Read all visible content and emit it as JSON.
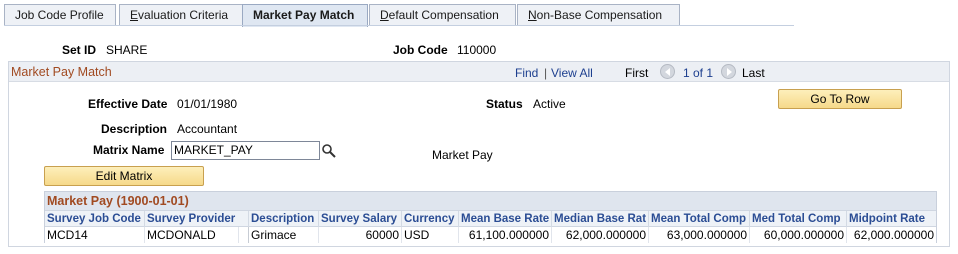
{
  "tabs": [
    {
      "label": "Job Code Profile",
      "underline": "",
      "rest": "Job Code Profile"
    },
    {
      "label": "Evaluation Criteria",
      "underline": "E",
      "rest": "valuation Criteria"
    },
    {
      "label": "Market Pay Match",
      "underline": "",
      "rest": "Market Pay Match",
      "active": true
    },
    {
      "label": "Default Compensation",
      "underline": "D",
      "rest": "efault Compensation"
    },
    {
      "label": "Non-Base Compensation",
      "underline": "N",
      "rest": "on-Base Compensation"
    }
  ],
  "header": {
    "setid_label": "Set ID",
    "setid_value": "SHARE",
    "jobcode_label": "Job Code",
    "jobcode_value": "110000"
  },
  "section": {
    "title": "Market Pay Match",
    "find": "Find",
    "sep": "|",
    "view_all": "View All",
    "first": "First",
    "count": "1 of 1",
    "last": "Last"
  },
  "fields": {
    "effdt_label": "Effective Date",
    "effdt_value": "01/01/1980",
    "status_label": "Status",
    "status_value": "Active",
    "descr_label": "Description",
    "descr_value": "Accountant",
    "matrix_label": "Matrix Name",
    "matrix_value": "MARKET_PAY",
    "matrix_descr": "Market Pay"
  },
  "buttons": {
    "go_to_row": "Go To Row",
    "edit_matrix": "Edit Matrix"
  },
  "grid": {
    "title": "Market Pay  (1900-01-01)",
    "columns": [
      "Survey Job Code",
      "Survey Provider",
      "Description",
      "Survey Salary",
      "Currency",
      "Mean Base Rate",
      "Median Base Rat",
      "Mean Total Comp",
      "Med Total Comp",
      "Midpoint Rate"
    ],
    "row": [
      "MCD14",
      "MCDONALD",
      "Grimace",
      "60000",
      "USD",
      "61,100.000000",
      "62,000.000000",
      "63,000.000000",
      "60,000.000000",
      "62,000.000000"
    ]
  },
  "colors": {
    "accent_orange": "#a14a21",
    "link_blue": "#1d3f8f",
    "button_gold": "#f6d98a"
  }
}
